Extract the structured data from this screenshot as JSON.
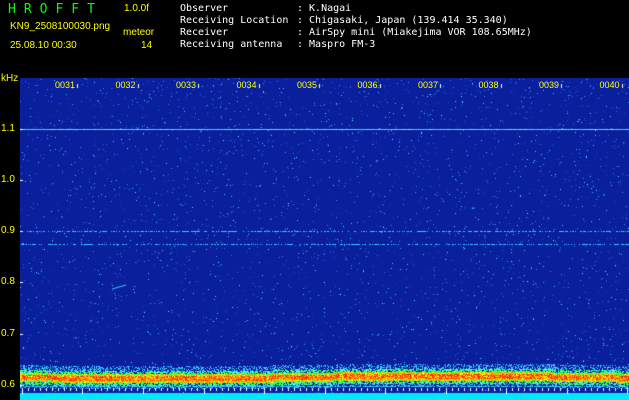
{
  "header": {
    "app_title": "HROFFT",
    "version": "1.0.0f",
    "filename": "KN9_2508100030.png",
    "mode": "meteor",
    "datetime": "25.08.10 00:30",
    "count": "14"
  },
  "info": [
    {
      "label": "Observer",
      "value": ": K.Nagai"
    },
    {
      "label": "Receiving Location",
      "value": ": Chigasaki, Japan (139.414 35.340)"
    },
    {
      "label": "Receiver",
      "value": ": AirSpy mini (Miakejima VOR 108.65MHz)"
    },
    {
      "label": "Receiving antenna",
      "value": ": Maspro FM-3"
    }
  ],
  "colors": {
    "title": "#00ff00",
    "version": "#ffff00",
    "header_text": "#ffff00",
    "info_text": "#ffffff",
    "time_label": "#ffff00",
    "spectrogram_bg": "#0a1f9c",
    "noise_light": "#3cc8ff",
    "noise_cyan": "#4cf0ff",
    "tick_marks": "#ffffff",
    "bottom_bar": "#00e8ff",
    "band_red": "#ff2a00",
    "band_orange": "#ff9a00",
    "band_yellow": "#ffee00",
    "band_green": "#30ff40"
  },
  "spectrogram": {
    "unit_label": "kHz",
    "y_ticks": [
      {
        "label": "1.1",
        "value": 1.1
      },
      {
        "label": "1.0",
        "value": 1.0
      },
      {
        "label": "0.9",
        "value": 0.9
      },
      {
        "label": "0.8",
        "value": 0.8
      },
      {
        "label": "0.7",
        "value": 0.7
      },
      {
        "label": "0.6",
        "value": 0.6
      }
    ],
    "freq_range": [
      0.57,
      1.2
    ],
    "time_labels": [
      "0031",
      "0032",
      "0033",
      "0034",
      "0035",
      "0036",
      "0037",
      "0038",
      "0039",
      "0040"
    ],
    "carrier_lines_khz": [
      1.1,
      0.9,
      0.875
    ],
    "band_center_khz": 0.615,
    "bottom_line_khz": 0.598
  }
}
